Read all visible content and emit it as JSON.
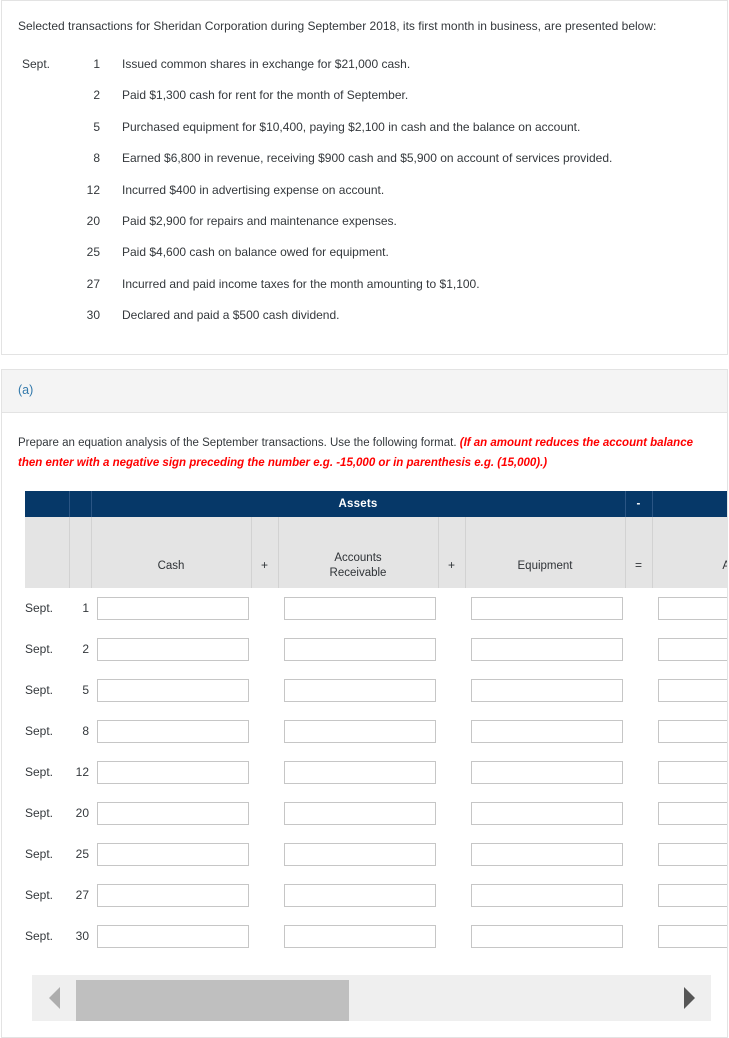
{
  "problem": {
    "intro": "Selected transactions for Sheridan Corporation during September 2018, its first month in business, are presented below:",
    "month_label": "Sept.",
    "transactions": [
      {
        "month": "Sept.",
        "day": "1",
        "description": "Issued common shares in exchange for $21,000 cash."
      },
      {
        "month": "",
        "day": "2",
        "description": "Paid $1,300 cash for rent for the month of September."
      },
      {
        "month": "",
        "day": "5",
        "description": "Purchased equipment for $10,400, paying $2,100 in cash and the balance on account."
      },
      {
        "month": "",
        "day": "8",
        "description": "Earned $6,800 in revenue, receiving $900 cash and $5,900 on account of services provided."
      },
      {
        "month": "",
        "day": "12",
        "description": "Incurred $400 in advertising expense on account."
      },
      {
        "month": "",
        "day": "20",
        "description": "Paid $2,900 for repairs and maintenance expenses."
      },
      {
        "month": "",
        "day": "25",
        "description": "Paid $4,600 cash on balance owed for equipment."
      },
      {
        "month": "",
        "day": "27",
        "description": "Incurred and paid income taxes for the month amounting to $1,100."
      },
      {
        "month": "",
        "day": "30",
        "description": "Declared and paid a $500 cash dividend."
      }
    ]
  },
  "part_a": {
    "label": "(a)",
    "instruction_main": "Prepare an equation analysis of the September transactions. Use the following format.",
    "instruction_hint": "(If an amount reduces the account balance then enter with a negative sign preceding the number e.g. -15,000 or in parenthesis e.g. (15,000).)",
    "table": {
      "group_headers": [
        {
          "label": "Assets",
          "span": 5
        },
        {
          "label": "-",
          "span": 1
        },
        {
          "label": "",
          "span": 1
        }
      ],
      "assets_label": "Assets",
      "minus_label": "-",
      "columns": [
        {
          "key": "cash",
          "label": "Cash",
          "operator": ""
        },
        {
          "key": "op1",
          "label": "",
          "operator": "+"
        },
        {
          "key": "ar",
          "label": "Accounts\nReceivable",
          "operator": ""
        },
        {
          "key": "op2",
          "label": "",
          "operator": "+"
        },
        {
          "key": "equipment",
          "label": "Equipment",
          "operator": ""
        },
        {
          "key": "op3",
          "label": "",
          "operator": "="
        },
        {
          "key": "ap",
          "label": "Acc",
          "operator": ""
        }
      ],
      "col_cash": "Cash",
      "col_ar_line1": "Accounts",
      "col_ar_line2": "Receivable",
      "col_equipment": "Equipment",
      "col_ap_partial": "Acc",
      "op_plus": "+",
      "op_equals": "=",
      "op_minus": "-",
      "rows": [
        {
          "month": "Sept.",
          "day": "1",
          "cash": "",
          "ar": "",
          "equipment": "",
          "ap": ""
        },
        {
          "month": "Sept.",
          "day": "2",
          "cash": "",
          "ar": "",
          "equipment": "",
          "ap": ""
        },
        {
          "month": "Sept.",
          "day": "5",
          "cash": "",
          "ar": "",
          "equipment": "",
          "ap": ""
        },
        {
          "month": "Sept.",
          "day": "8",
          "cash": "",
          "ar": "",
          "equipment": "",
          "ap": ""
        },
        {
          "month": "Sept.",
          "day": "12",
          "cash": "",
          "ar": "",
          "equipment": "",
          "ap": ""
        },
        {
          "month": "Sept.",
          "day": "20",
          "cash": "",
          "ar": "",
          "equipment": "",
          "ap": ""
        },
        {
          "month": "Sept.",
          "day": "25",
          "cash": "",
          "ar": "",
          "equipment": "",
          "ap": ""
        },
        {
          "month": "Sept.",
          "day": "27",
          "cash": "",
          "ar": "",
          "equipment": "",
          "ap": ""
        },
        {
          "month": "Sept.",
          "day": "30",
          "cash": "",
          "ar": "",
          "equipment": "",
          "ap": ""
        }
      ]
    },
    "scrollbar": {
      "left_arrow_icon": "chevron-left-icon",
      "right_arrow_icon": "chevron-right-icon"
    }
  },
  "colors": {
    "header_navy": "#063868",
    "subheader_gray": "#e4e4e4",
    "part_label_blue": "#3279ab",
    "hint_red": "#ff0000",
    "scroll_thumb": "#bfbfbf"
  }
}
